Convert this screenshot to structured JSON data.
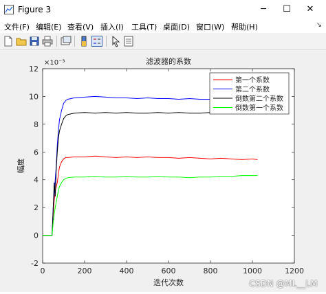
{
  "window": {
    "title": "Figure 3",
    "min_glyph": "─",
    "max_glyph": "☐",
    "close_glyph": "✕"
  },
  "menu": [
    "文件(F)",
    "编辑(E)",
    "查看(V)",
    "插入(I)",
    "工具(T)",
    "桌面(D)",
    "窗口(W)",
    "帮助(H)"
  ],
  "menu_dock_glyph": "↘",
  "toolbar": [
    "new-figure-icon",
    "open-file-icon",
    "save-icon",
    "print-icon",
    "link-plot-icon",
    "insert-colorbar-icon",
    "insert-legend-icon",
    "edit-plot-icon",
    "property-inspector-icon"
  ],
  "watermark": "CSDN @ML__LM",
  "chart_data": {
    "type": "line",
    "title": "滤波器的系数",
    "xlabel": "迭代次数",
    "ylabel": "幅度",
    "y_multiplier": "×10⁻³",
    "xlim": [
      0,
      1200
    ],
    "ylim": [
      -2,
      12
    ],
    "xticks": [
      0,
      200,
      400,
      600,
      800,
      1000,
      1200
    ],
    "yticks": [
      -2,
      0,
      2,
      4,
      6,
      8,
      10,
      12
    ],
    "grid": false,
    "legend_position": "top-right",
    "series": [
      {
        "name": "第一个系数",
        "color": "#ff0000",
        "x": [
          0,
          45,
          50,
          55,
          60,
          65,
          70,
          75,
          80,
          90,
          100,
          110,
          120,
          150,
          200,
          250,
          300,
          350,
          400,
          450,
          500,
          550,
          600,
          650,
          700,
          750,
          800,
          850,
          900,
          950,
          1000,
          1025
        ],
        "y": [
          0,
          0,
          1.5,
          2.5,
          3.2,
          3.5,
          3.8,
          4.4,
          4.9,
          5.3,
          5.5,
          5.6,
          5.6,
          5.65,
          5.65,
          5.7,
          5.65,
          5.6,
          5.65,
          5.6,
          5.65,
          5.6,
          5.6,
          5.55,
          5.6,
          5.55,
          5.5,
          5.55,
          5.5,
          5.45,
          5.5,
          5.45
        ]
      },
      {
        "name": "第二个系数",
        "color": "#0000ff",
        "x": [
          0,
          45,
          50,
          55,
          60,
          65,
          70,
          75,
          80,
          90,
          100,
          110,
          120,
          150,
          200,
          250,
          300,
          350,
          400,
          450,
          500,
          550,
          600,
          650,
          700,
          750,
          800,
          850,
          900,
          950,
          1000,
          1025
        ],
        "y": [
          0,
          0,
          2.0,
          3.0,
          4.0,
          5.0,
          6.5,
          7.5,
          8.3,
          9.0,
          9.5,
          9.7,
          9.8,
          9.9,
          9.95,
          10.0,
          9.95,
          9.9,
          9.9,
          9.85,
          9.9,
          9.85,
          9.85,
          9.8,
          9.85,
          9.8,
          9.8,
          9.75,
          9.8,
          9.75,
          9.8,
          9.8
        ]
      },
      {
        "name": "倒数第二个系数",
        "color": "#000000",
        "x": [
          0,
          45,
          50,
          55,
          60,
          65,
          70,
          75,
          80,
          90,
          100,
          110,
          120,
          150,
          200,
          250,
          300,
          350,
          400,
          450,
          500,
          550,
          600,
          650,
          700,
          750,
          800,
          850,
          900,
          950,
          1000,
          1025
        ],
        "y": [
          0,
          0,
          1.8,
          3.8,
          2.8,
          4.8,
          6.0,
          7.0,
          7.5,
          8.0,
          8.4,
          8.6,
          8.7,
          8.8,
          8.85,
          8.8,
          8.85,
          8.8,
          8.85,
          8.8,
          8.8,
          8.85,
          8.8,
          8.85,
          8.8,
          8.8,
          8.85,
          8.8,
          8.85,
          8.8,
          8.8,
          8.8
        ]
      },
      {
        "name": "倒数第一个系数",
        "color": "#00ff00",
        "x": [
          0,
          45,
          50,
          55,
          60,
          65,
          70,
          75,
          80,
          90,
          100,
          110,
          120,
          150,
          200,
          250,
          300,
          350,
          400,
          450,
          500,
          550,
          600,
          650,
          700,
          750,
          800,
          850,
          900,
          950,
          1000,
          1025
        ],
        "y": [
          0,
          0,
          0.9,
          1.5,
          2.0,
          2.4,
          2.8,
          3.2,
          3.5,
          3.8,
          4.0,
          4.1,
          4.15,
          4.2,
          4.2,
          4.25,
          4.2,
          4.2,
          4.25,
          4.2,
          4.2,
          4.25,
          4.2,
          4.2,
          4.15,
          4.2,
          4.2,
          4.25,
          4.25,
          4.3,
          4.3,
          4.3
        ]
      }
    ]
  }
}
